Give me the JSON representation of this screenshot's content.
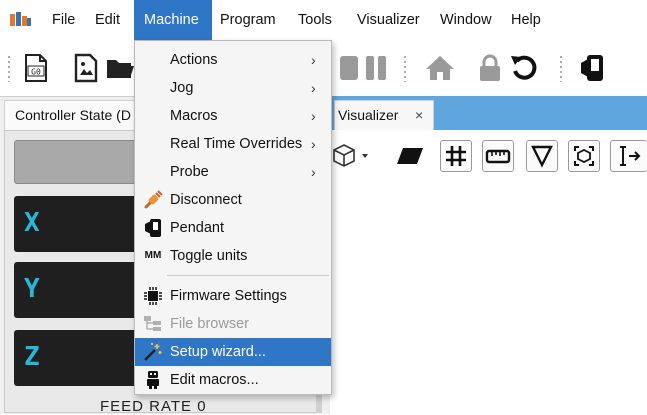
{
  "menubar": {
    "items": [
      "File",
      "Edit",
      "Machine",
      "Program",
      "Tools",
      "Visualizer",
      "Window",
      "Help"
    ],
    "open_item": "Machine"
  },
  "toolbar": {
    "gcode_icon_text": "G0"
  },
  "left_panel": {
    "tab_title": "Controller State (D",
    "axes": [
      "X",
      "Y",
      "Z"
    ],
    "feed_rate_label": "FEED RATE 0"
  },
  "visualizer": {
    "tab_title": "Visualizer",
    "close_glyph": "×",
    "tab_bar_color": "#5fa5de"
  },
  "machine_menu": {
    "items": [
      {
        "label": "Actions",
        "submenu": true
      },
      {
        "label": "Jog",
        "submenu": true
      },
      {
        "label": "Macros",
        "submenu": true
      },
      {
        "label": "Real Time Overrides",
        "submenu": true
      },
      {
        "label": "Probe",
        "submenu": true
      },
      {
        "label": "Disconnect",
        "icon": "plug-icon"
      },
      {
        "label": "Pendant",
        "icon": "pendant-phone-icon"
      },
      {
        "label": "Toggle units",
        "icon_text": "MM"
      },
      {
        "label": "Firmware Settings",
        "icon": "chip-icon"
      },
      {
        "label": "File browser",
        "icon": "file-tree-icon",
        "disabled": true
      },
      {
        "label": "Setup wizard...",
        "icon": "magic-wand-icon",
        "highlighted": true
      },
      {
        "label": "Edit macros...",
        "icon": "robot-icon"
      }
    ],
    "highlight_color": "#2f76c6",
    "submenu_arrow": "›"
  }
}
